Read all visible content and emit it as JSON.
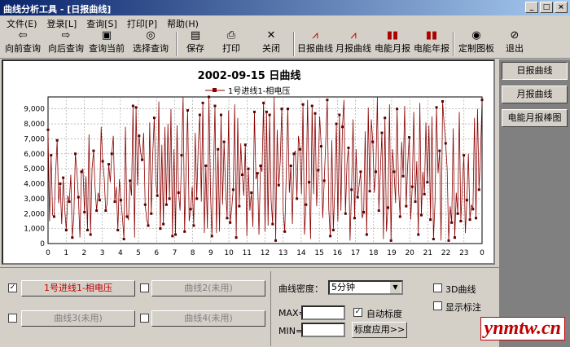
{
  "window": {
    "title": "曲线分析工具 - [日报曲线]"
  },
  "menu": [
    "文件(E)",
    "登录[L]",
    "查询[S]",
    "打印[P]",
    "帮助(H)"
  ],
  "toolbar": [
    {
      "label": "向前查询",
      "icon": "left-arrow-icon"
    },
    {
      "label": "向后查询",
      "icon": "right-arrow-icon"
    },
    {
      "label": "查询当前",
      "icon": "query-current-icon"
    },
    {
      "label": "选择查询",
      "icon": "globe-icon"
    },
    {
      "label": "保存",
      "icon": "save-icon"
    },
    {
      "label": "打印",
      "icon": "printer-icon"
    },
    {
      "label": "关闭",
      "icon": "close-icon"
    },
    {
      "label": "日报曲线",
      "icon": "line-chart-icon"
    },
    {
      "label": "月报曲线",
      "icon": "line-chart-icon"
    },
    {
      "label": "电能月报",
      "icon": "bar-chart-icon"
    },
    {
      "label": "电能年报",
      "icon": "bar-chart-icon"
    },
    {
      "label": "定制图板",
      "icon": "disk-icon"
    },
    {
      "label": "退出",
      "icon": "exit-icon"
    }
  ],
  "side_tabs": [
    "日报曲线",
    "月报曲线",
    "电能月报棒图"
  ],
  "curves": [
    {
      "label": "1号进线1-相电压",
      "checked": true
    },
    {
      "label": "曲线2(未用)",
      "checked": false
    },
    {
      "label": "曲线3(未用)",
      "checked": false
    },
    {
      "label": "曲线4(未用)",
      "checked": false
    }
  ],
  "settings": {
    "density_label": "曲线密度：",
    "density_value": "5分钟",
    "max_label": "MAX=",
    "min_label": "MIN=",
    "auto_scale_label": "自动标度",
    "apply_label": "标度应用>>",
    "threed_label": "3D曲线",
    "show_label": "显示标注"
  },
  "watermark": "ynmtw.cn",
  "chart_data": {
    "type": "line",
    "title": "2002-09-15 日曲线",
    "series": [
      {
        "name": "1号进线1-相电压",
        "color": "#8b0000",
        "values": [
          7600,
          1500,
          5900,
          1900,
          1800,
          4700,
          6900,
          2700,
          4000,
          1300,
          4400,
          2300,
          900,
          3200,
          2800,
          4600,
          400,
          1800,
          6000,
          4800,
          3100,
          400,
          4800,
          5000,
          2100,
          4500,
          900,
          7300,
          600,
          5000,
          6200,
          3700,
          2200,
          3400,
          2900,
          7800,
          5500,
          4400,
          2200,
          2700,
          5300,
          4100,
          6000,
          7200,
          2800,
          3800,
          900,
          4300,
          2900,
          1800,
          300,
          7800,
          1800,
          1600,
          4200,
          3200,
          9200,
          400,
          9100,
          3900,
          7200,
          6100,
          5600,
          7400,
          2600,
          1600,
          1200,
          8100,
          2000,
          6000,
          8400,
          4100,
          3200,
          9500,
          1000,
          6600,
          1300,
          7800,
          2600,
          8000,
          3000,
          9000,
          500,
          6300,
          600,
          7900,
          3400,
          2200,
          5900,
          9800,
          800,
          5100,
          8900,
          1500,
          2300,
          3800,
          1200,
          7400,
          3000,
          6600,
          8600,
          2800,
          9400,
          700,
          5200,
          1000,
          9800,
          3600,
          500,
          4600,
          9200,
          700,
          6300,
          800,
          8600,
          2600,
          6800,
          3700,
          1700,
          8900,
          1400,
          2300,
          3600,
          9300,
          400,
          8400,
          2500,
          6700,
          4600,
          3200,
          6600,
          500,
          5000,
          2200,
          3400,
          1100,
          8800,
          4300,
          4700,
          600,
          5200,
          4800,
          9400,
          800,
          8800,
          1200,
          8600,
          2900,
          1300,
          9800,
          200,
          7600,
          3900,
          5500,
          9000,
          2100,
          800,
          4800,
          9000,
          3400,
          5200,
          1300,
          6000,
          6200,
          3000,
          7200,
          6300,
          3300,
          9300,
          600,
          2600,
          9600,
          4100,
          300,
          9200,
          3300,
          8700,
          2500,
          4900,
          8500,
          6500,
          1700,
          4200,
          6800,
          9600,
          2300,
          500,
          6900,
          900,
          3800,
          8000,
          1500,
          8600,
          2200,
          7800,
          9600,
          2000,
          5400,
          6400,
          200,
          3600,
          8300,
          1700,
          6300,
          3100,
          3900,
          4800,
          1700,
          2100,
          7500,
          600,
          9100,
          3500,
          8300,
          6800,
          3400,
          4800,
          9800,
          2200,
          4900,
          7400,
          300,
          8400,
          800,
          2400,
          9300,
          200,
          6300,
          4800,
          2700,
          9000,
          3600,
          1800,
          6800,
          4500,
          9200,
          2500,
          5300,
          7100,
          1600,
          3800,
          8800,
          2800,
          5500,
          600,
          9400,
          1900,
          4800,
          3300,
          8100,
          4100,
          7900,
          1600,
          8500,
          300,
          2800,
          9100,
          4700,
          6200,
          200,
          9500,
          8000,
          6700,
          5000,
          200,
          2500,
          1400,
          7700,
          400,
          3400,
          2000,
          8800,
          1500,
          3800,
          5900,
          700,
          2900,
          6000,
          1600,
          2600,
          2300,
          8400,
          1700,
          9000,
          3600,
          6000,
          9600
        ]
      }
    ],
    "x_ticks": [
      "0",
      "1",
      "2",
      "3",
      "4",
      "5",
      "6",
      "7",
      "8",
      "9",
      "10",
      "11",
      "12",
      "13",
      "14",
      "15",
      "16",
      "17",
      "18",
      "19",
      "20",
      "21",
      "22",
      "23",
      "0"
    ],
    "y_ticks": [
      "0",
      "1,000",
      "2,000",
      "3,000",
      "4,000",
      "5,000",
      "6,000",
      "7,000",
      "8,000",
      "9,000"
    ],
    "ylim": [
      0,
      9800
    ],
    "grid": true,
    "legend": "top-center"
  }
}
